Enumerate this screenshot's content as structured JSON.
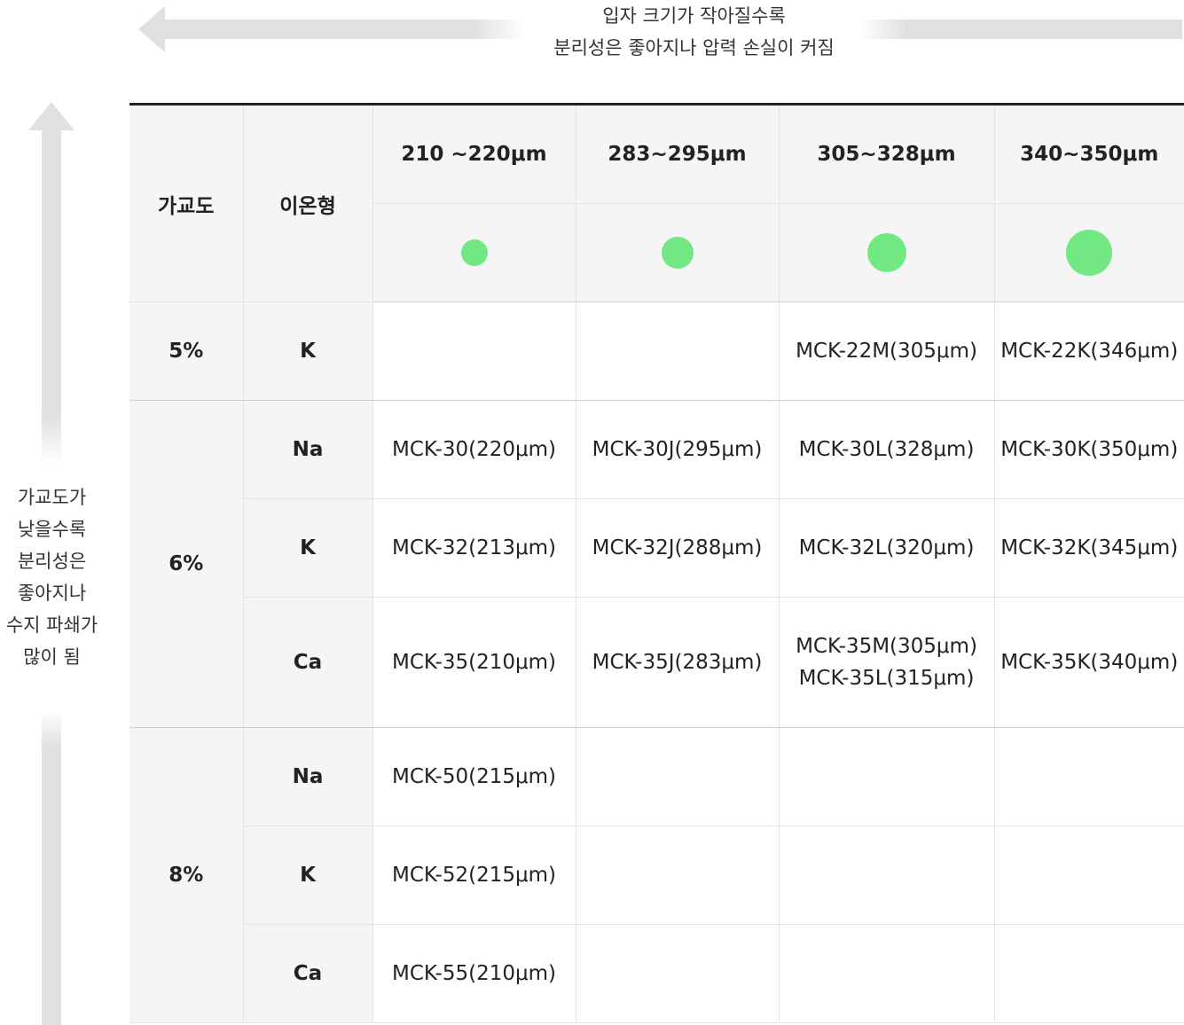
{
  "top_caption": {
    "line1": "입자 크기가 작아질수록",
    "line2": "분리성은 좋아지나 압력 손실이 커짐"
  },
  "left_caption": {
    "lines": [
      "가교도가",
      "낮을수록",
      "분리성은",
      "좋아지나",
      "수지 파쇄가",
      "많이 됨"
    ]
  },
  "accent_color": "#72e883",
  "header": {
    "crosslink": "가교도",
    "ion_type": "이온형",
    "sizes": [
      "210 ~220μm",
      "283~295μm",
      "305~328μm",
      "340~350μm"
    ]
  },
  "particle_size_indicators": [
    0.54,
    0.64,
    0.78,
    0.92
  ],
  "rows": [
    {
      "crosslink": "5%",
      "ions": [
        {
          "ion": "K",
          "cells": [
            "",
            "",
            "MCK-22M(305μm)",
            "MCK-22K(346μm)"
          ]
        }
      ]
    },
    {
      "crosslink": "6%",
      "ions": [
        {
          "ion": "Na",
          "cells": [
            "MCK-30(220μm)",
            "MCK-30J(295μm)",
            "MCK-30L(328μm)",
            "MCK-30K(350μm)"
          ]
        },
        {
          "ion": "K",
          "cells": [
            "MCK-32(213μm)",
            "MCK-32J(288μm)",
            "MCK-32L(320μm)",
            "MCK-32K(345μm)"
          ]
        },
        {
          "ion": "Ca",
          "cells": [
            "MCK-35(210μm)",
            "MCK-35J(283μm)",
            "MCK-35M(305μm)",
            "MCK-35K(340μm)"
          ],
          "extra": {
            "col": 2,
            "text": "MCK-35L(315μm)"
          }
        }
      ]
    },
    {
      "crosslink": "8%",
      "ions": [
        {
          "ion": "Na",
          "cells": [
            "MCK-50(215μm)",
            "",
            "",
            ""
          ]
        },
        {
          "ion": "K",
          "cells": [
            "MCK-52(215μm)",
            "",
            "",
            ""
          ]
        },
        {
          "ion": "Ca",
          "cells": [
            "MCK-55(210μm)",
            "",
            "",
            ""
          ]
        }
      ]
    }
  ]
}
